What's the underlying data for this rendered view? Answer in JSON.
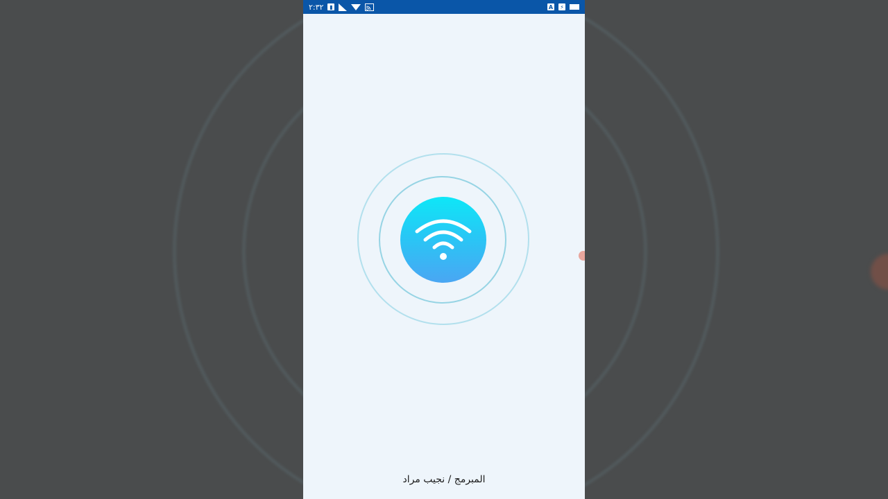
{
  "statusbar": {
    "time": "٢:٣٢",
    "left_icons": [
      "battery-saver-icon",
      "signal-icon",
      "wifi-icon",
      "cast-icon"
    ],
    "right_icons": [
      "font-a-icon",
      "sim-icon",
      "battery-icon"
    ],
    "font_letter": "A"
  },
  "main": {
    "icon": "wifi-icon",
    "accent_start": "#0ee7f7",
    "accent_end": "#4aa6f3"
  },
  "footer": {
    "credit": "المبرمج / نجيب مراد"
  },
  "colors": {
    "statusbar": "#0a56a8",
    "screen_bg": "#eef5fb",
    "ring": "#8cd0e0"
  }
}
